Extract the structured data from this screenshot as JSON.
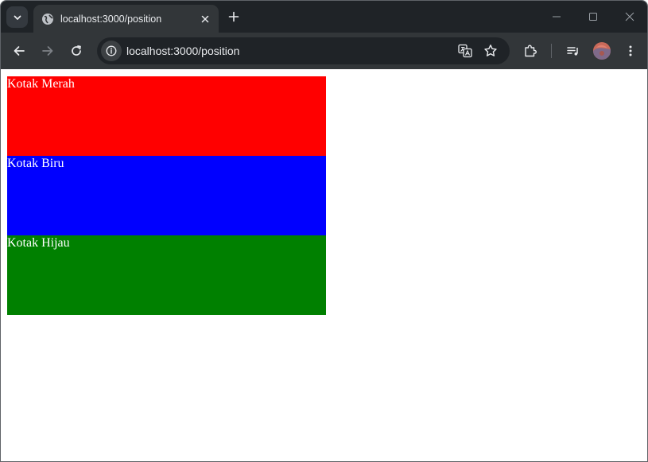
{
  "browser": {
    "tab": {
      "title": "localhost:3000/position",
      "icon": "globe-icon"
    },
    "address_bar": {
      "url": "localhost:3000/position"
    },
    "colors": {
      "frame": "#1f2327",
      "toolbar": "#323639",
      "text": "#e8eaed"
    }
  },
  "page": {
    "boxes": [
      {
        "label": "Kotak Merah",
        "color": "#ff0000"
      },
      {
        "label": "Kotak Biru",
        "color": "#0000ff"
      },
      {
        "label": "Kotak Hijau",
        "color": "#008000"
      }
    ]
  }
}
